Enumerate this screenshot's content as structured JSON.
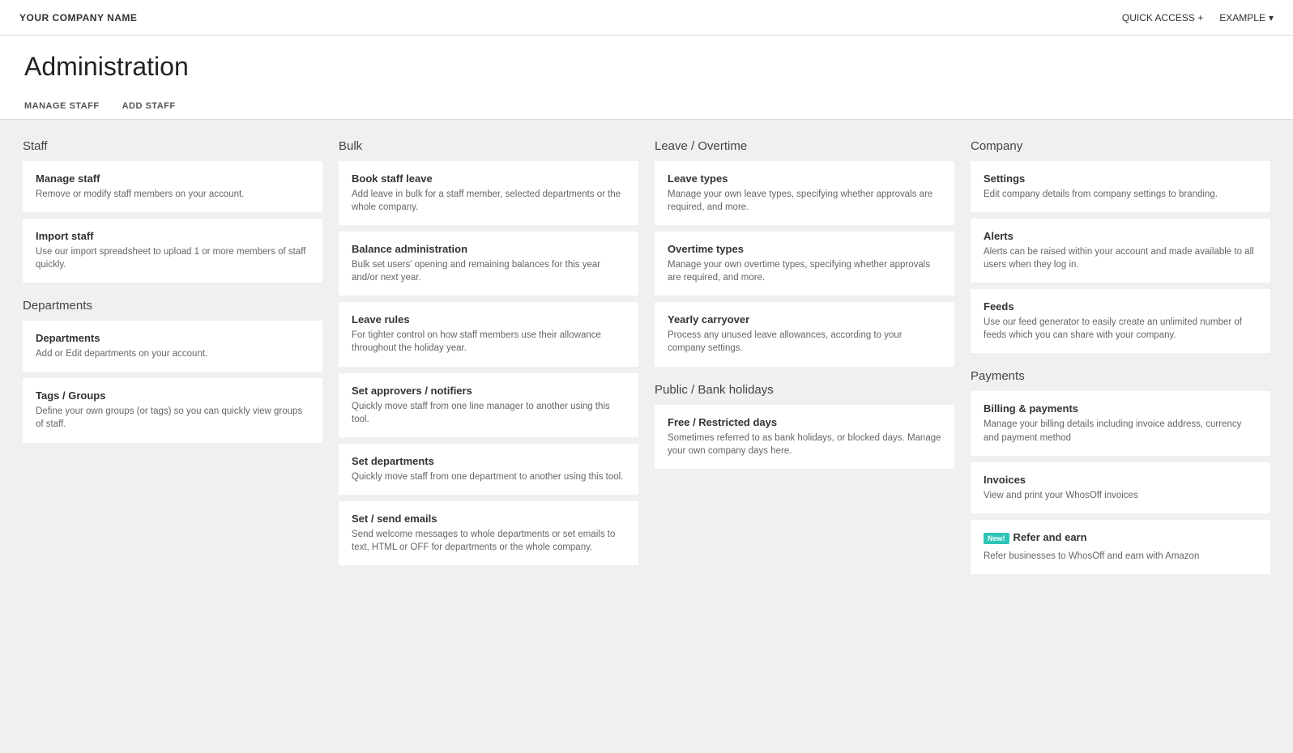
{
  "topNav": {
    "companyName": "YOUR COMPANY NAME",
    "quickAccess": "QUICK ACCESS",
    "quickAccessIcon": "+",
    "example": "EXAMPLE",
    "exampleIcon": "▾"
  },
  "header": {
    "title": "Administration",
    "tabs": [
      {
        "id": "manage-staff",
        "label": "MANAGE STAFF"
      },
      {
        "id": "add-staff",
        "label": "ADD STAFF"
      }
    ]
  },
  "sections": [
    {
      "id": "staff",
      "title": "Staff",
      "cards": [
        {
          "id": "manage-staff",
          "title": "Manage staff",
          "desc": "Remove or modify staff members on your account."
        },
        {
          "id": "import-staff",
          "title": "Import staff",
          "desc": "Use our import spreadsheet to upload 1 or more members of staff quickly."
        }
      ],
      "subsections": [
        {
          "id": "departments-section",
          "title": "Departments",
          "cards": [
            {
              "id": "departments",
              "title": "Departments",
              "desc": "Add or Edit departments on your account."
            },
            {
              "id": "tags-groups",
              "title": "Tags / Groups",
              "desc": "Define your own groups (or tags) so you can quickly view groups of staff."
            }
          ]
        }
      ]
    },
    {
      "id": "bulk",
      "title": "Bulk",
      "cards": [
        {
          "id": "book-staff-leave",
          "title": "Book staff leave",
          "desc": "Add leave in bulk for a staff member, selected departments or the whole company."
        },
        {
          "id": "balance-administration",
          "title": "Balance administration",
          "desc": "Bulk set users' opening and remaining balances for this year and/or next year."
        },
        {
          "id": "leave-rules",
          "title": "Leave rules",
          "desc": "For tighter control on how staff members use their allowance throughout the holiday year."
        },
        {
          "id": "set-approvers",
          "title": "Set approvers / notifiers",
          "desc": "Quickly move staff from one line manager to another using this tool."
        },
        {
          "id": "set-departments",
          "title": "Set departments",
          "desc": "Quickly move staff from one department to another using this tool."
        },
        {
          "id": "set-send-emails",
          "title": "Set / send emails",
          "desc": "Send welcome messages to whole departments or set emails to text, HTML or OFF for departments or the whole company."
        }
      ]
    },
    {
      "id": "leave-overtime",
      "title": "Leave / Overtime",
      "cards": [
        {
          "id": "leave-types",
          "title": "Leave types",
          "desc": "Manage your own leave types, specifying whether approvals are required, and more."
        },
        {
          "id": "overtime-types",
          "title": "Overtime types",
          "desc": "Manage your own overtime types, specifying whether approvals are required, and more."
        },
        {
          "id": "yearly-carryover",
          "title": "Yearly carryover",
          "desc": "Process any unused leave allowances, according to your company settings."
        }
      ],
      "subsections": [
        {
          "id": "public-bank-holidays",
          "title": "Public / Bank holidays",
          "cards": [
            {
              "id": "free-restricted-days",
              "title": "Free / Restricted days",
              "desc": "Sometimes referred to as bank holidays, or blocked days. Manage your own company days here."
            }
          ]
        }
      ]
    },
    {
      "id": "company",
      "title": "Company",
      "cards": [
        {
          "id": "settings",
          "title": "Settings",
          "desc": "Edit company details from company settings to branding."
        },
        {
          "id": "alerts",
          "title": "Alerts",
          "desc": "Alerts can be raised within your account and made available to all users when they log in."
        },
        {
          "id": "feeds",
          "title": "Feeds",
          "desc": "Use our feed generator to easily create an unlimited number of feeds which you can share with your company."
        }
      ],
      "subsections": [
        {
          "id": "payments-section",
          "title": "Payments",
          "cards": [
            {
              "id": "billing-payments",
              "title": "Billing & payments",
              "desc": "Manage your billing details including invoice address, currency and payment method"
            },
            {
              "id": "invoices",
              "title": "Invoices",
              "desc": "View and print your WhosOff invoices"
            },
            {
              "id": "refer-earn",
              "title": "Refer and earn",
              "desc": "Refer businesses to WhosOff and earn with Amazon",
              "badge": "New!"
            }
          ]
        }
      ]
    }
  ]
}
